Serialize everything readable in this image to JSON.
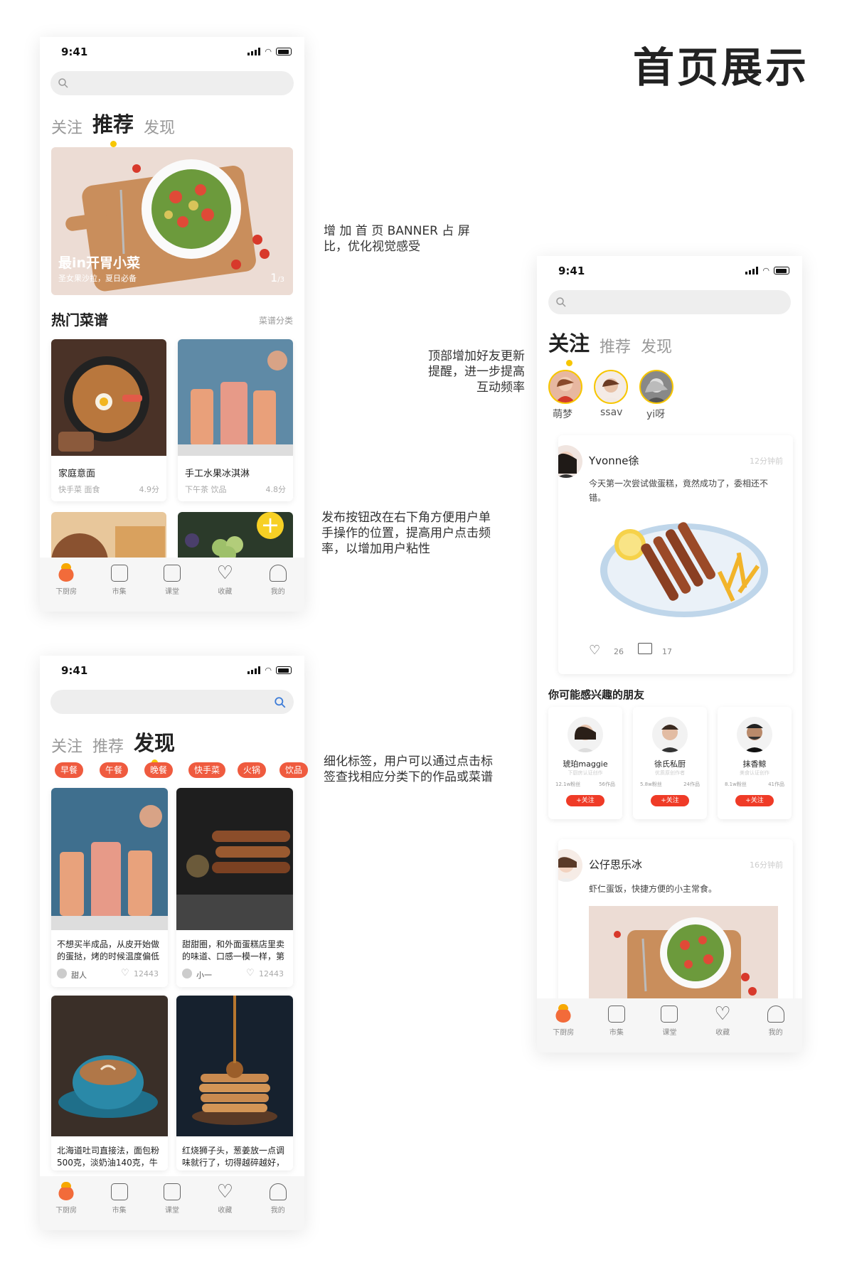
{
  "page_title": "首页展示",
  "status_time": "9:41",
  "notes": {
    "banner": "增 加 首 页 BANNER 占 屏比，优化视觉感受",
    "friends": "顶部增加好友更新提醒，进一步提高互动频率",
    "publish": "发布按钮改在右下角方便用户单手操作的位置，提高用户点击频率，以增加用户粘性",
    "tags": "细化标签，用户可以通过点击标签查找相应分类下的作品或菜谱"
  },
  "tabs": {
    "follow": "关注",
    "recommend": "推荐",
    "discover": "发现"
  },
  "tabbar": [
    {
      "label": "下厨房",
      "icon": "chef-home-icon"
    },
    {
      "label": "市集",
      "icon": "market-icon"
    },
    {
      "label": "课堂",
      "icon": "classroom-play-icon"
    },
    {
      "label": "收藏",
      "icon": "heart-icon"
    },
    {
      "label": "我的",
      "icon": "user-icon"
    }
  ],
  "screen1": {
    "banner": {
      "title": "最in开胃小菜",
      "subtitle": "圣女果沙拉，夏日必备",
      "pager_current": "1",
      "pager_total": "/3"
    },
    "section_title": "热门菜谱",
    "section_link": "菜谱分类",
    "recipes": [
      {
        "name": "家庭意面",
        "tags": "快手菜  面食",
        "rating": "4.9分"
      },
      {
        "name": "手工水果冰淇淋",
        "tags": "下午茶  饮品",
        "rating": "4.8分"
      }
    ],
    "fab": "+"
  },
  "screen2": {
    "chips": [
      "早餐",
      "午餐",
      "晚餐",
      "快手菜",
      "火锅",
      "饮品"
    ],
    "posts": [
      {
        "text": "不想买半成品，从皮开始做的蛋挞，烤的时候温度偏低",
        "author": "甜人",
        "likes": "12443"
      },
      {
        "text": "甜甜圈，和外面蛋糕店里卖的味道、口感一模一样，第",
        "author": "小一",
        "likes": "12443"
      },
      {
        "text": "北海道吐司直接法，面包粉500克，淡奶油140克，牛",
        "author": "",
        "likes": ""
      },
      {
        "text": "红烧狮子头，葱姜放一点调味就行了，切得越碎越好，",
        "author": "",
        "likes": ""
      }
    ]
  },
  "screen3": {
    "friends": [
      {
        "name": "萌梦"
      },
      {
        "name": "ssav"
      },
      {
        "name": "yi呀"
      }
    ],
    "feed1": {
      "user": "Yvonne徐",
      "time": "12分钟前",
      "text": "今天第一次尝试做蛋糕，竟然成功了，委相还不错。",
      "likes": "26",
      "comments": "17"
    },
    "suggest_title": "你可能感兴趣的朋友",
    "suggestions": [
      {
        "name": "琥珀maggie",
        "desc": "下厨房认证创作",
        "fans": "12.1w粉丝",
        "works": "56作品",
        "btn": "+关注"
      },
      {
        "name": "徐氏私厨",
        "desc": "优质原创作者",
        "fans": "5.8w粉丝",
        "works": "24作品",
        "btn": "+关注"
      },
      {
        "name": "抹香鲸",
        "desc": "美食认证创作",
        "fans": "8.1w粉丝",
        "works": "41作品",
        "btn": "+关注"
      }
    ],
    "feed2": {
      "user": "公仔思乐冰",
      "time": "16分钟前",
      "text": "虾仁蛋饭，快捷方便的小主常食。"
    }
  }
}
